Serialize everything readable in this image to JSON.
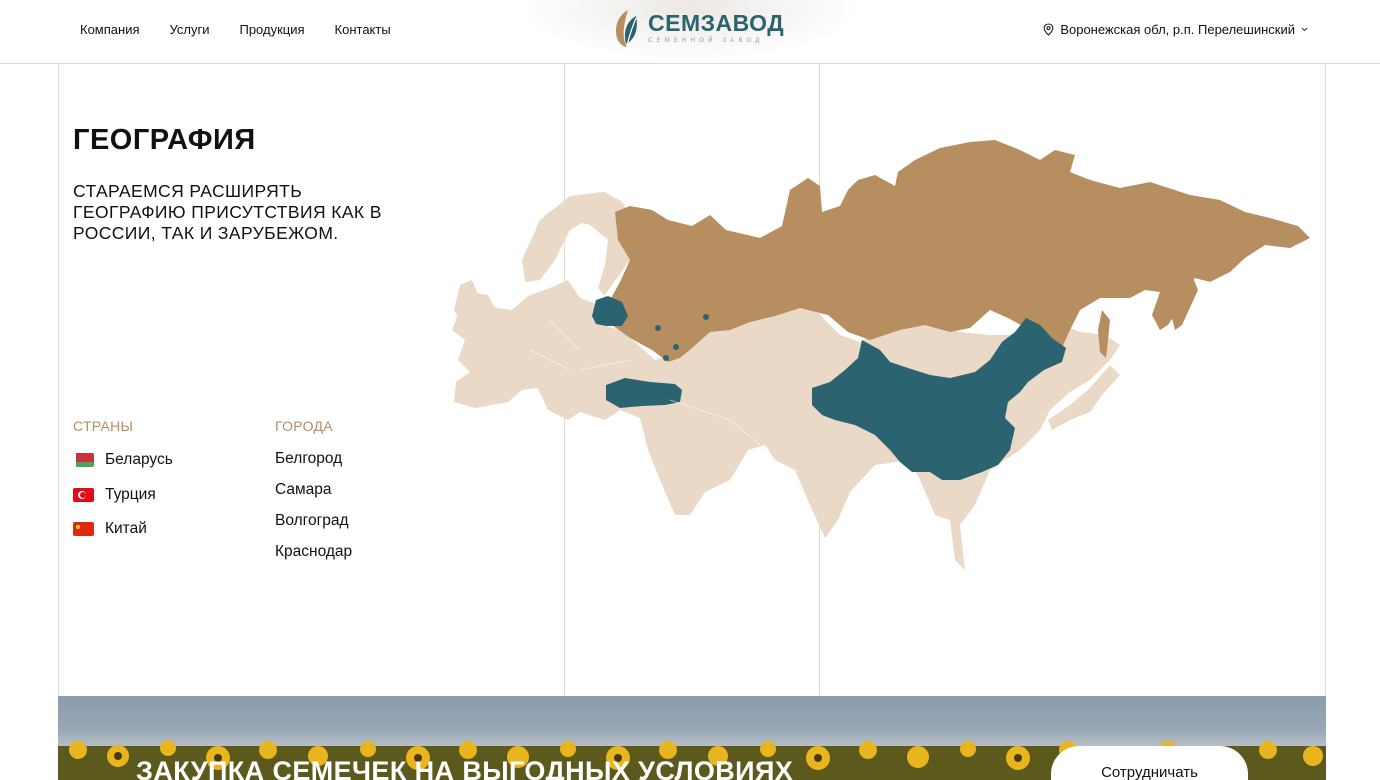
{
  "header": {
    "nav": [
      "Компания",
      "Услуги",
      "Продукция",
      "Контакты"
    ],
    "logo": {
      "name": "СЕМЗАВОД",
      "tagline": "СЕМЕННОЙ ЗАВОД"
    },
    "region": "Воронежская обл, р.п. Перелешинский",
    "region_icon": "location-pin-icon",
    "region_dropdown_icon": "chevron-down-icon"
  },
  "geography": {
    "title": "ГЕОГРАФИЯ",
    "subtitle": "СТАРАЕМСЯ РАСШИРЯТЬ ГЕОГРАФИЮ ПРИСУТСТВИЯ КАК В РОССИИ, ТАК И ЗАРУБЕЖОМ.",
    "countries_heading": "СТРАНЫ",
    "cities_heading": "ГОРОДА",
    "countries": [
      {
        "name": "Беларусь",
        "flag": "belarus-flag-icon"
      },
      {
        "name": "Турция",
        "flag": "turkey-flag-icon"
      },
      {
        "name": "Китай",
        "flag": "china-flag-icon"
      }
    ],
    "cities": [
      "Белгород",
      "Самара",
      "Волгоград",
      "Краснодар"
    ]
  },
  "colors": {
    "accent_teal": "#2b6470",
    "russia_brown": "#b68e5f",
    "other_beige": "#ead9c6",
    "heading_gold": "#b68e5f",
    "border": "#e6dccb"
  },
  "banner": {
    "title": "ЗАКУПКА СЕМЕЧЕК НА ВЫГОДНЫХ УСЛОВИЯХ",
    "button": "Сотрудничать"
  }
}
